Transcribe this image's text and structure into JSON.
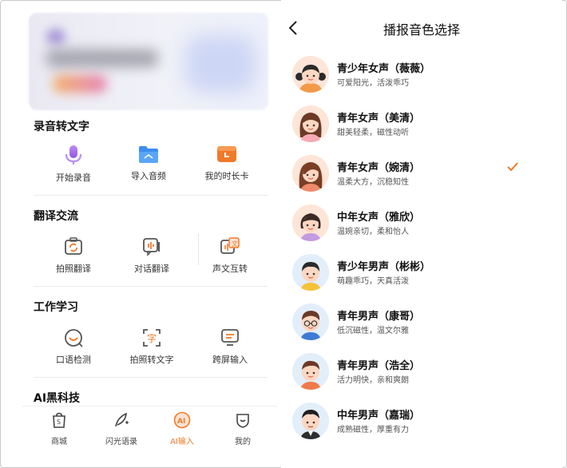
{
  "left": {
    "sections": [
      {
        "title": "录音转文字",
        "items": [
          {
            "label": "开始录音",
            "icon": "microphone-icon",
            "color": "#a36ae8"
          },
          {
            "label": "导入音频",
            "icon": "folder-icon",
            "color": "#3c8ef0"
          },
          {
            "label": "我的时长卡",
            "icon": "clock-card-icon",
            "color": "#f07a2a"
          }
        ]
      },
      {
        "title": "翻译交流",
        "items": [
          {
            "label": "拍照翻译",
            "icon": "camera-translate-icon"
          },
          {
            "label": "对话翻译",
            "icon": "dialog-translate-icon"
          },
          {
            "label": "声文互转",
            "icon": "voice-text-convert-icon"
          }
        ]
      },
      {
        "title": "工作学习",
        "items": [
          {
            "label": "口语检测",
            "icon": "speech-check-icon"
          },
          {
            "label": "拍照转文字",
            "icon": "photo-to-text-icon"
          },
          {
            "label": "跨屏输入",
            "icon": "cross-screen-input-icon"
          }
        ]
      },
      {
        "title": "AI黑科技",
        "items": []
      }
    ],
    "bottom_nav": [
      {
        "label": "商城",
        "icon": "shop-bag-icon",
        "active": false
      },
      {
        "label": "闪光语录",
        "icon": "quill-pen-icon",
        "active": false
      },
      {
        "label": "AI输入",
        "icon": "ai-input-icon",
        "active": true
      },
      {
        "label": "我的",
        "icon": "profile-shield-icon",
        "active": false
      }
    ],
    "accent": "#f07a2a"
  },
  "right": {
    "title": "播报音色选择",
    "voices": [
      {
        "name": "青少年女声（薇薇）",
        "desc": "可爱阳光，活泼乖巧",
        "selected": false
      },
      {
        "name": "青年女声（美清）",
        "desc": "甜美轻柔，磁性动听",
        "selected": false
      },
      {
        "name": "青年女声（婉清）",
        "desc": "温柔大方，沉稳知性",
        "selected": true
      },
      {
        "name": "中年女声（雅欣）",
        "desc": "温婉亲切，柔和怡人",
        "selected": false
      },
      {
        "name": "青少年男声（彬彬）",
        "desc": "萌趣乖巧，天真活泼",
        "selected": false
      },
      {
        "name": "青年男声（康哥）",
        "desc": "低沉磁性，温文尔雅",
        "selected": false
      },
      {
        "name": "青年男声（浩全）",
        "desc": "活力明快，亲和爽朗",
        "selected": false
      },
      {
        "name": "中年男声（嘉瑞）",
        "desc": "成熟磁性，厚重有力",
        "selected": false
      }
    ],
    "check_color": "#f07a2a"
  }
}
